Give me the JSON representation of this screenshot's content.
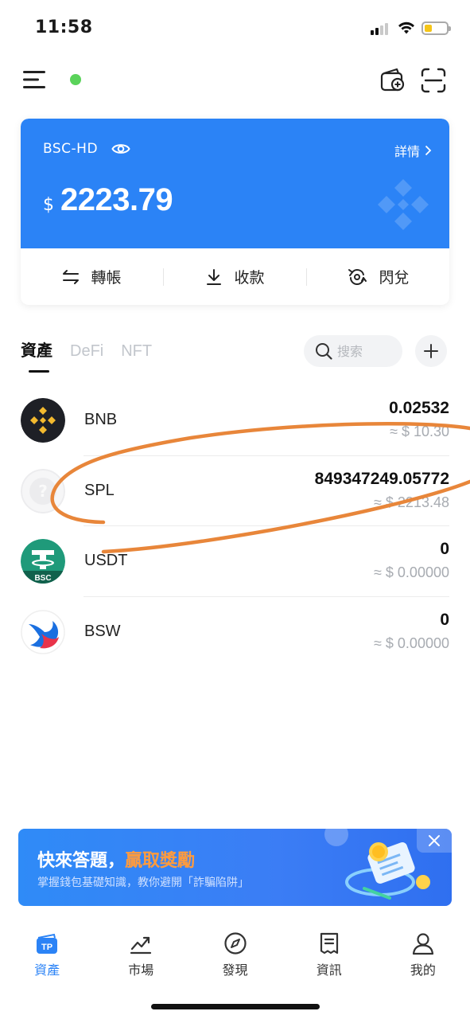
{
  "status_bar": {
    "time": "11:58",
    "battery_color": "#f5c518"
  },
  "toolbar": {
    "menu_icon": "menu-icon",
    "status_dot_color": "#5ad35a",
    "add_wallet_icon": "wallet-add-icon",
    "scan_icon": "scan-icon"
  },
  "wallet": {
    "name": "BSC-HD",
    "details_label": "詳情",
    "currency_symbol": "$",
    "balance": "2223.79",
    "accent_color": "#2b83f6",
    "actions": [
      {
        "label": "轉帳",
        "icon": "transfer-icon"
      },
      {
        "label": "收款",
        "icon": "receive-icon"
      },
      {
        "label": "閃兌",
        "icon": "swap-icon"
      }
    ]
  },
  "tabs": {
    "items": [
      {
        "label": "資產",
        "active": true
      },
      {
        "label": "DeFi",
        "active": false
      },
      {
        "label": "NFT",
        "active": false
      }
    ],
    "search_placeholder": "搜索"
  },
  "tokens": [
    {
      "symbol": "BNB",
      "amount": "0.02532",
      "fiat": "≈ $ 10.30"
    },
    {
      "symbol": "SPL",
      "amount": "849347249.05772",
      "fiat": "≈ $ 2213.48"
    },
    {
      "symbol": "USDT",
      "amount": "0",
      "fiat": "≈ $ 0.00000",
      "badge": "BSC"
    },
    {
      "symbol": "BSW",
      "amount": "0",
      "fiat": "≈ $ 0.00000"
    }
  ],
  "promo": {
    "title_main": "快來答題，",
    "title_highlight": "贏取獎勵",
    "subtitle": "掌握錢包基礎知識，教你避開「詐騙陷阱」"
  },
  "bottom_nav": [
    {
      "label": "資產",
      "icon": "assets-icon",
      "active": true
    },
    {
      "label": "市場",
      "icon": "market-icon",
      "active": false
    },
    {
      "label": "發現",
      "icon": "discover-icon",
      "active": false
    },
    {
      "label": "資訊",
      "icon": "news-icon",
      "active": false
    },
    {
      "label": "我的",
      "icon": "profile-icon",
      "active": false
    }
  ]
}
